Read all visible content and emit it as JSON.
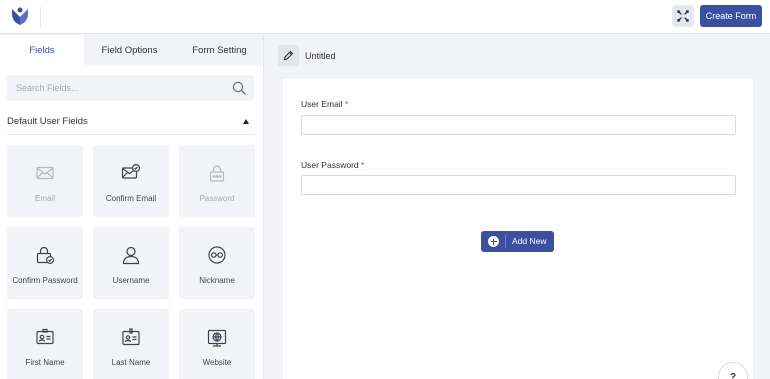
{
  "toolbar": {
    "create_label": "Create Form",
    "accent": "#3c4fa1"
  },
  "sidebar": {
    "tabs": [
      {
        "label": "Fields",
        "active": true
      },
      {
        "label": "Field Options",
        "active": false
      },
      {
        "label": "Form Setting",
        "active": false
      }
    ],
    "search_placeholder": "Search Fields...",
    "section_title": "Default User Fields",
    "fields": [
      {
        "label": "Email",
        "icon": "envelope-icon",
        "disabled": true
      },
      {
        "label": "Confirm Email",
        "icon": "envelope-check-icon",
        "disabled": false
      },
      {
        "label": "Password",
        "icon": "lock-icon",
        "disabled": true
      },
      {
        "label": "Confirm Password",
        "icon": "lock-check-icon",
        "disabled": false
      },
      {
        "label": "Username",
        "icon": "user-icon",
        "disabled": false
      },
      {
        "label": "Nickname",
        "icon": "mask-icon",
        "disabled": false
      },
      {
        "label": "First Name",
        "icon": "id-card-icon",
        "disabled": false
      },
      {
        "label": "Last Name",
        "icon": "id-badge-icon",
        "disabled": false
      },
      {
        "label": "Website",
        "icon": "website-icon",
        "disabled": false
      }
    ]
  },
  "canvas": {
    "title": "Untitled",
    "fields": [
      {
        "label": "User Email",
        "required": "*",
        "value": ""
      },
      {
        "label": "User Password",
        "required": "*",
        "value": ""
      }
    ],
    "add_new_label": "Add New"
  },
  "help": {
    "label": "?"
  }
}
